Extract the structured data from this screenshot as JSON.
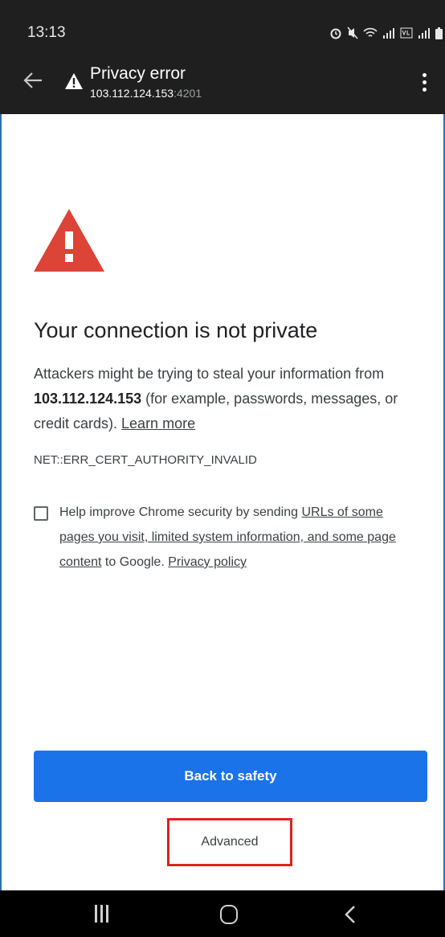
{
  "status_bar": {
    "time": "13:13",
    "icons": [
      "alarm-icon",
      "mute-icon",
      "wifi-icon",
      "signal-icon",
      "volte-icon",
      "signal-icon",
      "battery-icon"
    ]
  },
  "toolbar": {
    "title": "Privacy error",
    "url_host": "103.112.124.153",
    "url_port": ":4201"
  },
  "page": {
    "heading": "Your connection is not private",
    "desc_before": "Attackers might be trying to steal your information from ",
    "desc_host": "103.112.124.153",
    "desc_after": " (for example, passwords, messages, or credit cards). ",
    "learn_more": "Learn more",
    "error_code": "NET::ERR_CERT_AUTHORITY_INVALID",
    "help_before": "Help improve Chrome security by sending ",
    "help_link": "URLs of some pages you visit, limited system information, and some page content",
    "help_mid": " to Google. ",
    "privacy_policy": "Privacy policy",
    "checkbox_checked": false,
    "back_to_safety": "Back to safety",
    "advanced": "Advanced"
  },
  "colors": {
    "toolbar_bg": "#1f1f1f",
    "primary_button": "#1a73e8",
    "warning_red": "#db4437",
    "highlight_box": "#e0211f"
  }
}
